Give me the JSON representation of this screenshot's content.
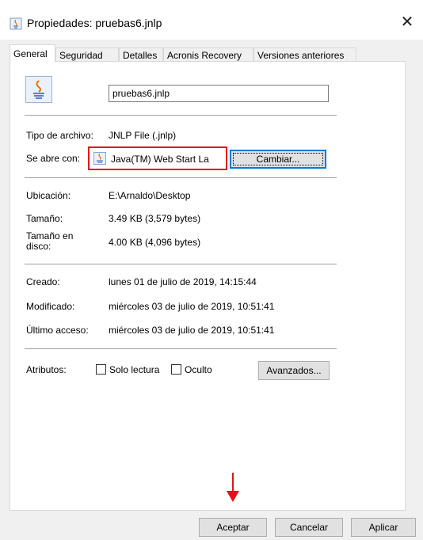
{
  "window": {
    "title": "Propiedades: pruebas6.jnlp",
    "close_glyph": "✕"
  },
  "tabs": [
    {
      "label": "General",
      "active": true
    },
    {
      "label": "Seguridad"
    },
    {
      "label": "Detalles"
    },
    {
      "label": "Acronis Recovery"
    },
    {
      "label": "Versiones anteriores"
    }
  ],
  "general": {
    "filename": "pruebas6.jnlp",
    "file_type_label": "Tipo de archivo:",
    "file_type_value": "JNLP File (.jnlp)",
    "opens_with_label": "Se abre con:",
    "opens_with_value": "Java(TM) Web Start La",
    "change_button": "Cambiar...",
    "location_label": "Ubicación:",
    "location_value": "E:\\Arnaldo\\Desktop",
    "size_label": "Tamaño:",
    "size_value": "3.49 KB (3,579 bytes)",
    "disk_size_label_1": "Tamaño en",
    "disk_size_label_2": "disco:",
    "disk_size_value": "4.00 KB (4,096 bytes)",
    "created_label": "Creado:",
    "created_value": "lunes 01 de julio de 2019, 14:15:44",
    "modified_label": "Modificado:",
    "modified_value": "miércoles 03 de julio de 2019, 10:51:41",
    "accessed_label": "Último acceso:",
    "accessed_value": "miércoles 03 de julio de 2019, 10:51:41",
    "attributes_label": "Atributos:",
    "readonly_label": "Solo lectura",
    "hidden_label": "Oculto",
    "advanced_button": "Avanzados..."
  },
  "footer": {
    "accept": "Aceptar",
    "cancel": "Cancelar",
    "apply": "Aplicar"
  },
  "icons": {
    "java": "java-icon",
    "annotation_arrow_color": "#e3101c",
    "highlight_color": "#e3101c"
  }
}
